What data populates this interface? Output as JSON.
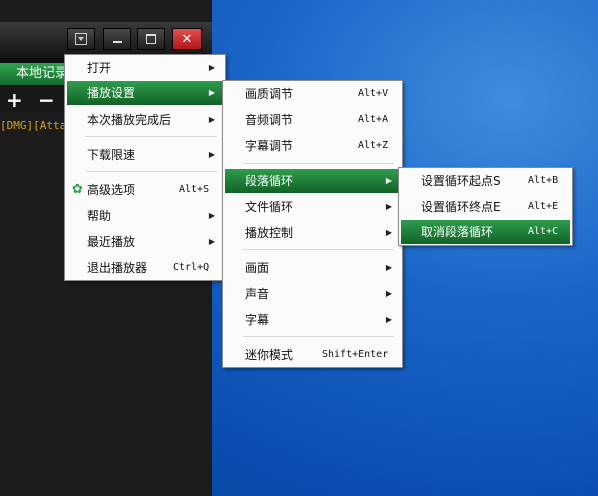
{
  "player": {
    "tab_label": "本地记录",
    "toolbar": {
      "add": "+",
      "remove": "−"
    },
    "list_line": "[DMG][Atta"
  },
  "menu_main": {
    "items": [
      {
        "label": "打开",
        "shortcut": "",
        "submenu": true
      },
      {
        "label": "播放设置",
        "shortcut": "",
        "submenu": true
      },
      {
        "label": "本次播放完成后",
        "shortcut": "",
        "submenu": true
      },
      {
        "label": "下载限速",
        "shortcut": "",
        "submenu": true
      },
      {
        "label": "高级选项",
        "shortcut": "Alt+S",
        "submenu": false
      },
      {
        "label": "帮助",
        "shortcut": "",
        "submenu": true
      },
      {
        "label": "最近播放",
        "shortcut": "",
        "submenu": true
      },
      {
        "label": "退出播放器",
        "shortcut": "Ctrl+Q",
        "submenu": false
      }
    ]
  },
  "menu_play": {
    "items": [
      {
        "label": "画质调节",
        "shortcut": "Alt+V"
      },
      {
        "label": "音频调节",
        "shortcut": "Alt+A"
      },
      {
        "label": "字幕调节",
        "shortcut": "Alt+Z"
      },
      {
        "label": "段落循环",
        "shortcut": ""
      },
      {
        "label": "文件循环",
        "shortcut": ""
      },
      {
        "label": "播放控制",
        "shortcut": ""
      },
      {
        "label": "画面",
        "shortcut": ""
      },
      {
        "label": "声音",
        "shortcut": ""
      },
      {
        "label": "字幕",
        "shortcut": ""
      },
      {
        "label": "迷你模式",
        "shortcut": "Shift+Enter"
      }
    ]
  },
  "menu_loop": {
    "items": [
      {
        "label": "设置循环起点S",
        "shortcut": "Alt+B"
      },
      {
        "label": "设置循环终点E",
        "shortcut": "Alt+E"
      },
      {
        "label": "取消段落循环",
        "shortcut": "Alt+C"
      }
    ]
  },
  "icons": {
    "menu_dropdown": "dropdown-square-icon",
    "minimize": "minimize-icon",
    "maximize": "maximize-icon",
    "close": "close-icon",
    "advanced": "gear-icon",
    "submenu": "submenu-arrow-icon"
  },
  "colors": {
    "highlight": "#1f8a3c",
    "close": "#c82a2a",
    "tag_text": "#d8a21a",
    "tab": "#1f8a3c"
  }
}
